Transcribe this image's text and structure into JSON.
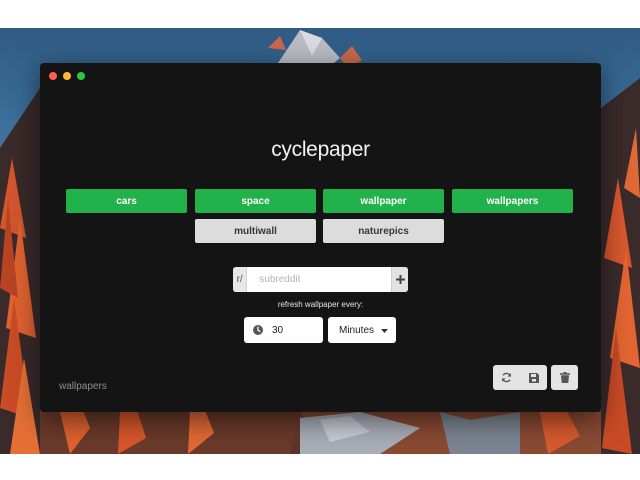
{
  "app": {
    "title": "cyclepaper"
  },
  "subreddits": {
    "active": [
      "cars",
      "space",
      "wallpaper",
      "wallpapers"
    ],
    "inactive": [
      "multiwall",
      "naturepics"
    ]
  },
  "add_subreddit": {
    "prefix": "r/",
    "placeholder": "subreddit",
    "add_icon": "plus-icon"
  },
  "refresh": {
    "label": "refresh wallpaper every:",
    "interval": "30",
    "unit": "Minutes",
    "clock_icon": "clock-icon"
  },
  "footer": {
    "current_label": "wallpapers"
  },
  "toolbar": {
    "refresh_icon": "refresh-icon",
    "save_icon": "save-icon",
    "delete_icon": "trash-icon"
  },
  "colors": {
    "window_bg": "#141414",
    "active_green": "#22b24c",
    "inactive_gray": "#dcdcdc"
  }
}
